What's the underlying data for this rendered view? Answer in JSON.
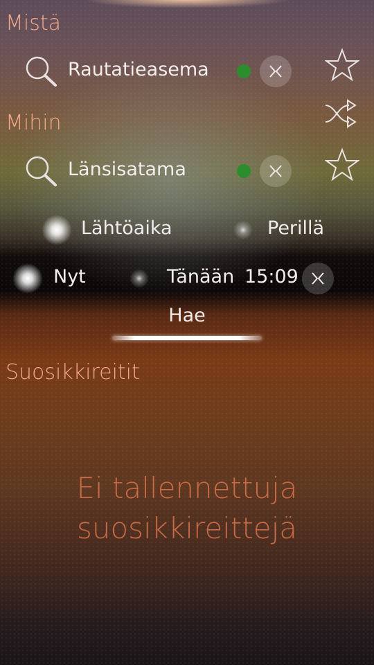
{
  "from": {
    "section_label": "Mistä",
    "value": "Rautatieasema"
  },
  "to": {
    "section_label": "Mihin",
    "value": "Länsisatama"
  },
  "time_mode": {
    "departure_label": "Lähtöaika",
    "arrival_label": "Perillä",
    "selected": "departure"
  },
  "time": {
    "now_label": "Nyt",
    "day_label": "Tänään",
    "clock": "15:09",
    "selected": "now"
  },
  "search_button": {
    "label": "Hae"
  },
  "favorites": {
    "section_label": "Suosikkireitit",
    "empty_line1": "Ei tallennettuja",
    "empty_line2": "suosikkireittejä"
  },
  "icons": {
    "search": "search-icon",
    "status": "green-dot",
    "clear": "clear-icon",
    "star": "star-icon",
    "swap": "swap-icon"
  },
  "colors": {
    "section_text": "#f2a98a",
    "status_green": "#2c8d2c",
    "empty_text": "#c96a47"
  }
}
